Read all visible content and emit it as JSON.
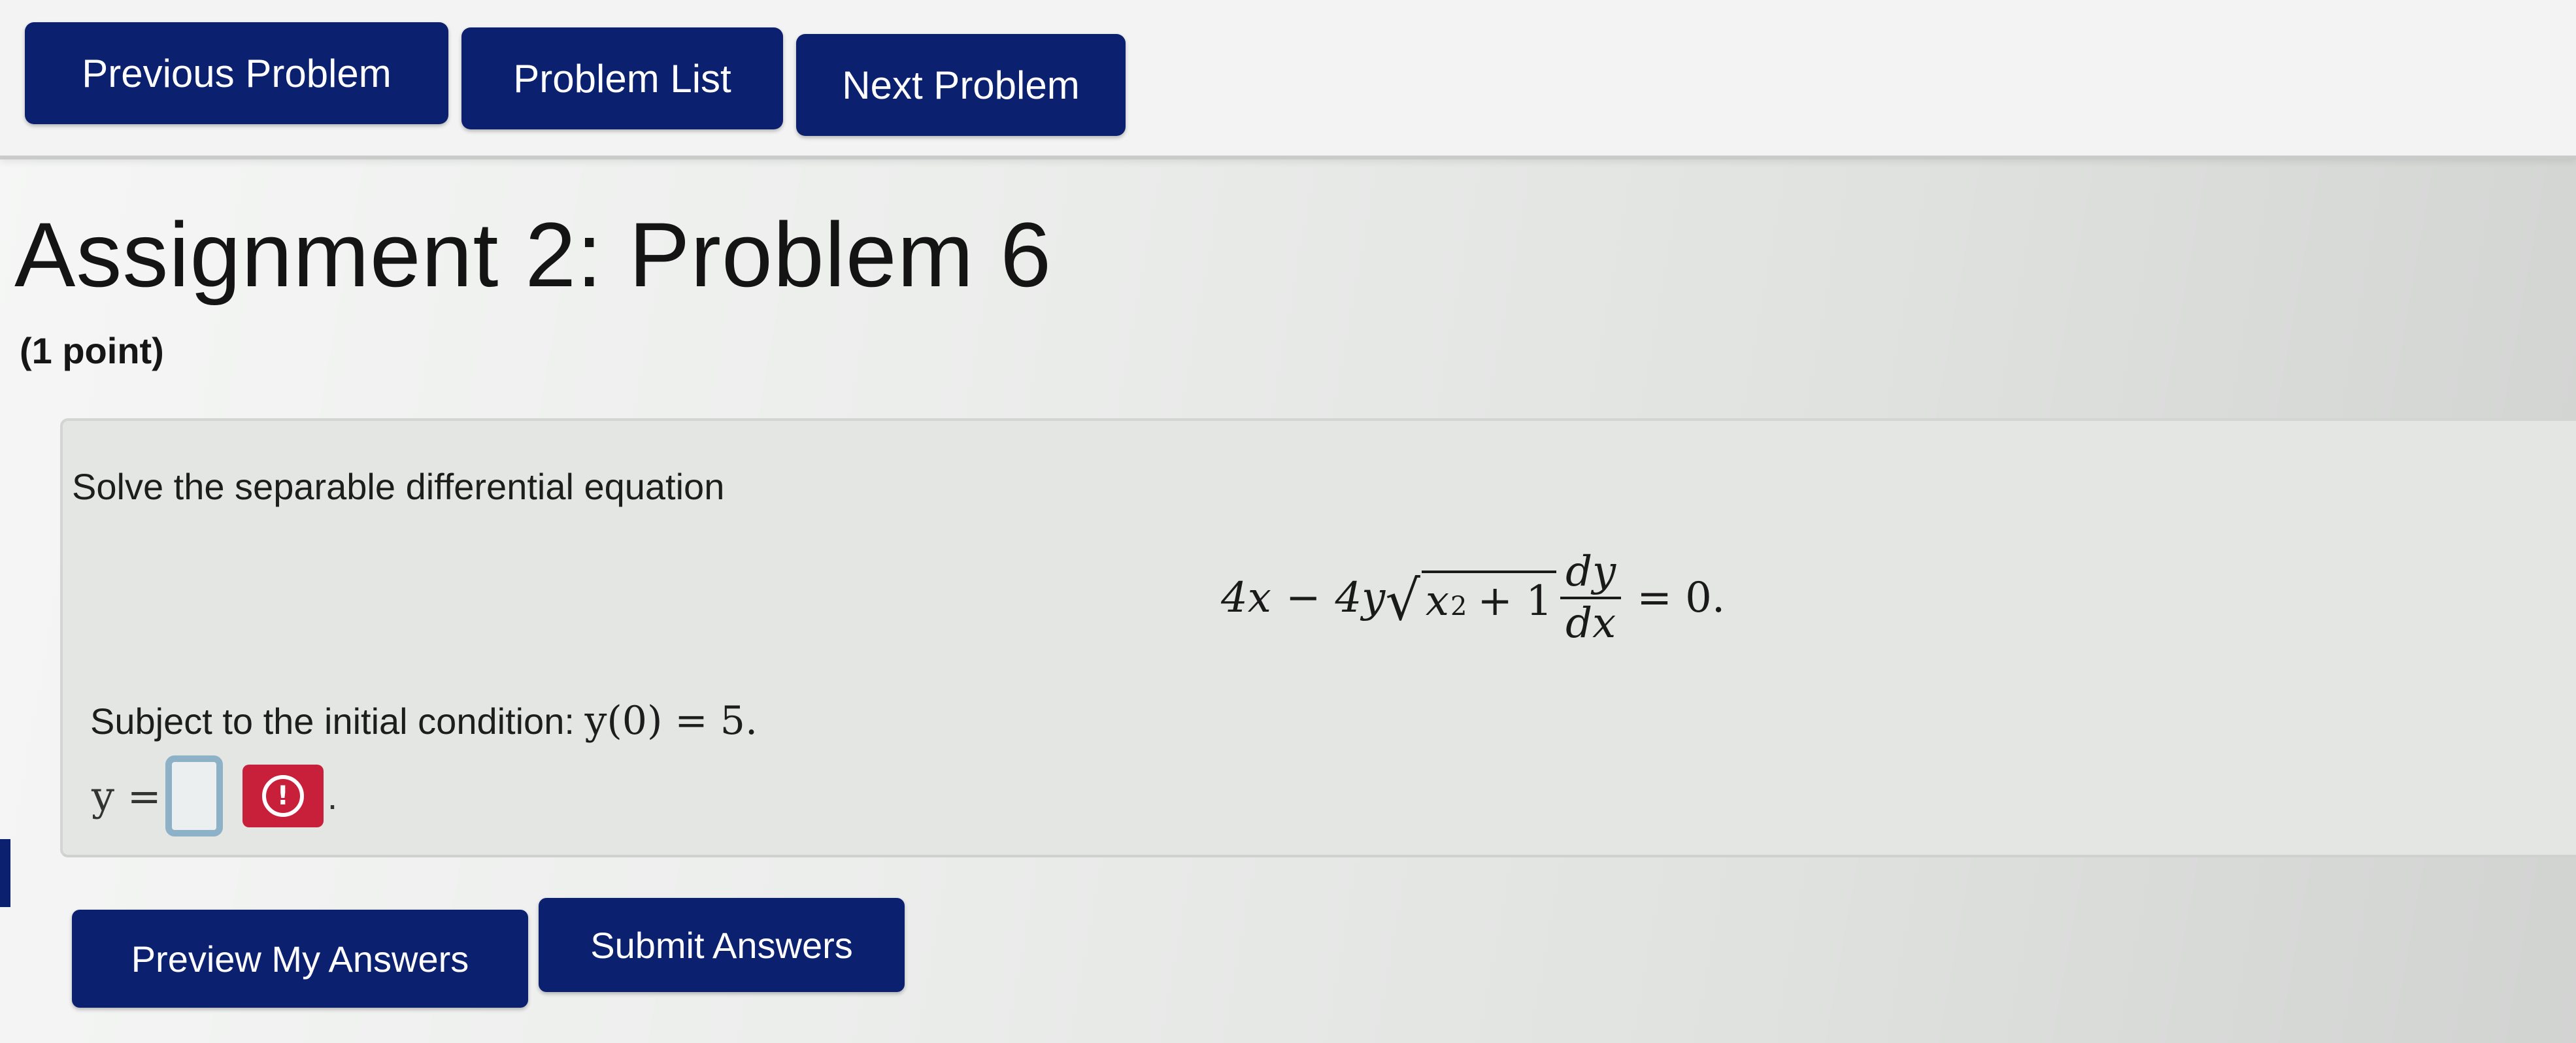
{
  "nav": {
    "previous_label": "Previous Problem",
    "list_label": "Problem List",
    "next_label": "Next Problem"
  },
  "problem": {
    "title": "Assignment 2: Problem 6",
    "points": "(1 point)",
    "statement": "Solve the separable differential equation",
    "equation": {
      "term1": "4x",
      "minus": "−",
      "term2": "4y",
      "radicand_var": "x",
      "radicand_exp": "2",
      "radicand_plus": "+ 1",
      "deriv_num": "dy",
      "deriv_den": "dx",
      "rhs": "= 0."
    },
    "condition_prefix": "Subject to the initial condition:",
    "condition_math": "y(0) = 5.",
    "answer_label": "y =",
    "answer_value": "",
    "warning_symbol": "!",
    "trailing_period": "."
  },
  "actions": {
    "preview_label": "Preview My Answers",
    "submit_label": "Submit Answers"
  },
  "colors": {
    "button_bg": "#0b2170",
    "warning_bg": "#c81f3a",
    "input_border": "#8db1c6"
  },
  "icons": {
    "warning": "exclamation-circle-icon",
    "radical": "square-root-icon"
  }
}
